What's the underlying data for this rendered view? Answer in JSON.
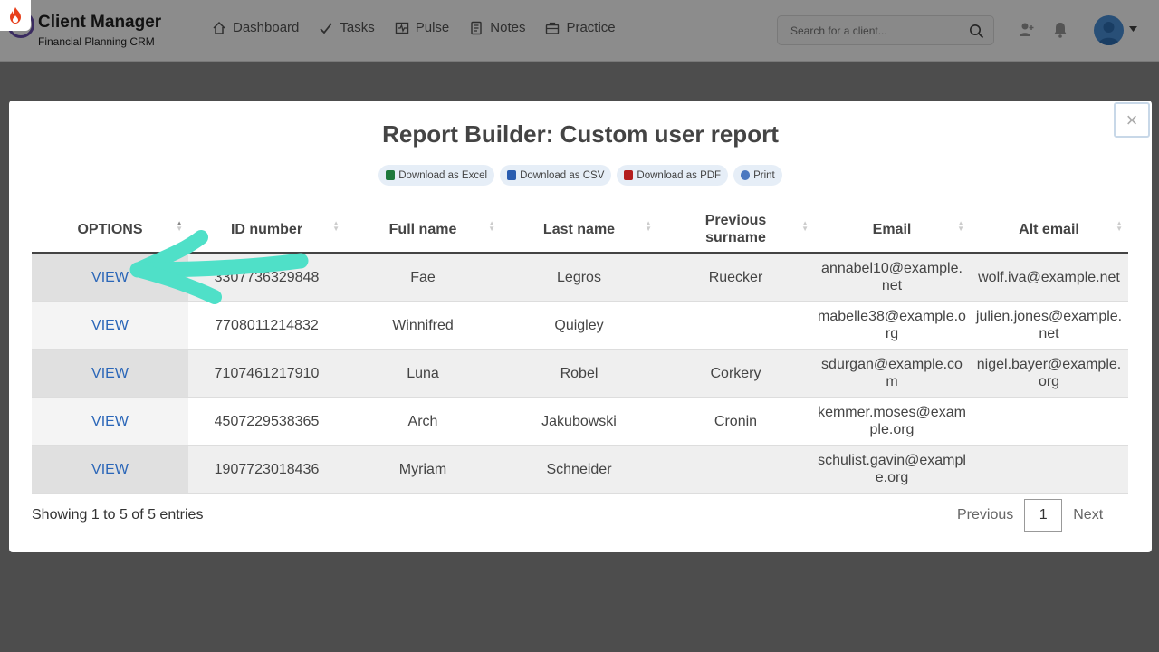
{
  "header": {
    "brand_title": "Client Manager",
    "brand_subtitle": "Financial Planning CRM",
    "nav": [
      {
        "label": "Dashboard",
        "icon": "home-icon"
      },
      {
        "label": "Tasks",
        "icon": "check-icon"
      },
      {
        "label": "Pulse",
        "icon": "pulse-icon"
      },
      {
        "label": "Notes",
        "icon": "notes-icon"
      },
      {
        "label": "Practice",
        "icon": "briefcase-icon"
      }
    ],
    "search_placeholder": "Search for a client..."
  },
  "modal": {
    "title": "Report Builder: Custom user report",
    "buttons": [
      {
        "label": "Download as Excel",
        "color": "#1e7a3c"
      },
      {
        "label": "Download as CSV",
        "color": "#2a5db0"
      },
      {
        "label": "Download as PDF",
        "color": "#b41e1e"
      },
      {
        "label": "Print",
        "color": "#4a78c0"
      }
    ],
    "columns": [
      "OPTIONS",
      "ID number",
      "Full name",
      "Last name",
      "Previous surname",
      "Email",
      "Alt email"
    ],
    "rows": [
      {
        "option": "VIEW",
        "id": "3307736329848",
        "full_name": "Fae",
        "last_name": "Legros",
        "previous": "Ruecker",
        "email": "annabel10@example.net",
        "alt_email": "wolf.iva@example.net"
      },
      {
        "option": "VIEW",
        "id": "7708011214832",
        "full_name": "Winnifred",
        "last_name": "Quigley",
        "previous": "",
        "email": "mabelle38@example.org",
        "alt_email": "julien.jones@example.net"
      },
      {
        "option": "VIEW",
        "id": "7107461217910",
        "full_name": "Luna",
        "last_name": "Robel",
        "previous": "Corkery",
        "email": "sdurgan@example.com",
        "alt_email": "nigel.bayer@example.org"
      },
      {
        "option": "VIEW",
        "id": "4507229538365",
        "full_name": "Arch",
        "last_name": "Jakubowski",
        "previous": "Cronin",
        "email": "kemmer.moses@example.org",
        "alt_email": ""
      },
      {
        "option": "VIEW",
        "id": "1907723018436",
        "full_name": "Myriam",
        "last_name": "Schneider",
        "previous": "",
        "email": "schulist.gavin@example.org",
        "alt_email": ""
      }
    ],
    "info": "Showing 1 to 5 of 5 entries",
    "pager": {
      "previous": "Previous",
      "page": "1",
      "next": "Next"
    },
    "close_symbol": "×"
  },
  "colors": {
    "accent_arrow": "#4fe0c8",
    "link": "#2a66b8"
  }
}
